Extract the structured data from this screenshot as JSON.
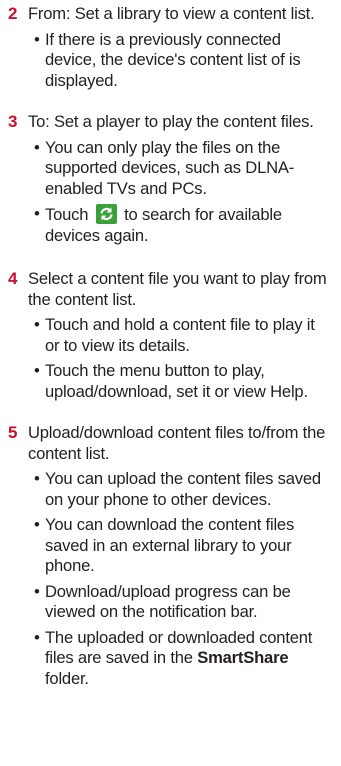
{
  "steps": [
    {
      "number": "2",
      "text": "From: Set a library to view a content list.",
      "bullets": [
        "If there is a previously connected device, the device's content list of is displayed."
      ]
    },
    {
      "number": "3",
      "text": "To: Set a player to play the content files.",
      "bullets": [
        "You can only play the files on the supported devices, such as DLNA-enabled TVs and PCs."
      ],
      "touch_bullet": {
        "before": "Touch",
        "icon": "refresh-icon",
        "after": "to search for available devices again."
      }
    },
    {
      "number": "4",
      "text": "Select a content file you want to play from the content list.",
      "bullets": [
        "Touch and hold a content file to play it or to view its details.",
        "Touch the menu button to play, upload/download, set it or view Help."
      ]
    },
    {
      "number": "5",
      "text": "Upload/download content files to/from the content list.",
      "bullets": [
        "You can upload the content files saved on your phone to other devices.",
        "You can download the content files saved in an external library to your phone.",
        "Download/upload progress can be viewed on the notification bar."
      ],
      "last_bullet": {
        "before": "The uploaded or downloaded content files are saved in the",
        "bold": "SmartShare",
        "after": "folder."
      }
    }
  ],
  "bullet_symbol": "•",
  "colors": {
    "step_number": "#c8102e",
    "text": "#231f20",
    "icon_bg": "#3aa13a"
  }
}
